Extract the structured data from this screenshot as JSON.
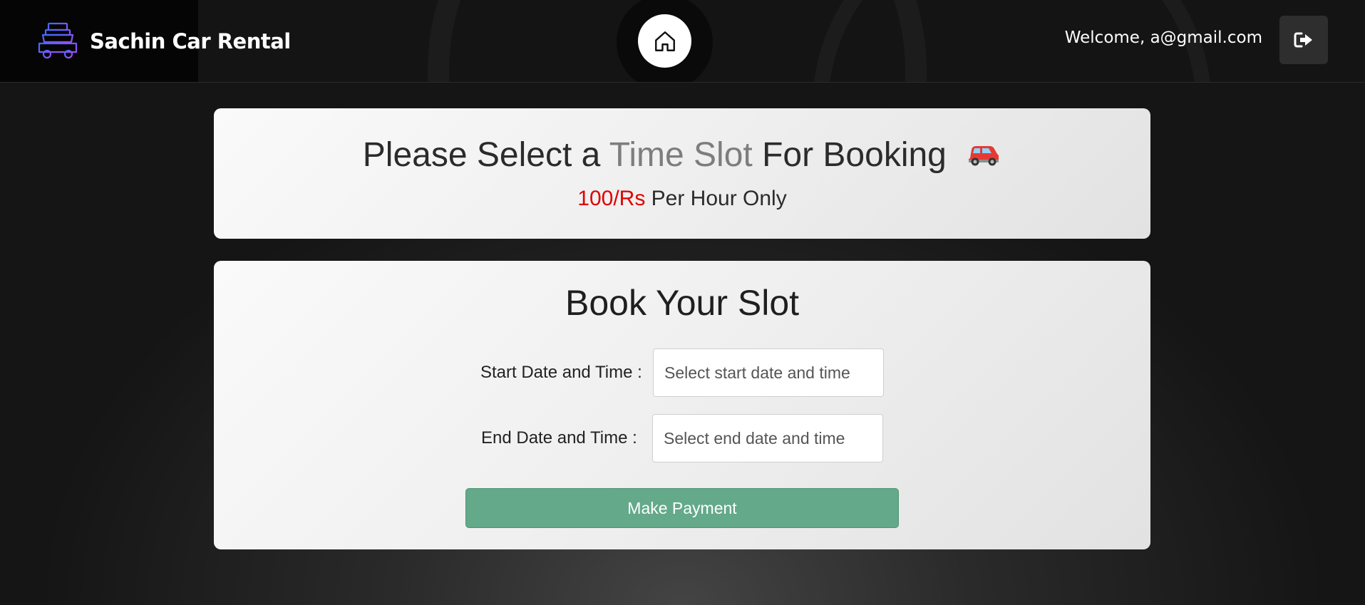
{
  "navbar": {
    "brand_name": "Sachin Car Rental",
    "brand_icon": "car-with-luggage-icon",
    "home_icon": "home-icon",
    "welcome_text": "Welcome, a@gmail.com",
    "logout_icon": "sign-out-icon"
  },
  "header_card": {
    "headline_prefix": "Please Select a ",
    "headline_accent": "Time Slot",
    "headline_suffix": " For Booking",
    "headline_emoji": "🚗",
    "price": "100/Rs",
    "price_suffix": " Per Hour Only"
  },
  "booking": {
    "title": "Book Your Slot",
    "start_label": "Start Date and Time :",
    "start_placeholder": "Select start date and time",
    "start_value": "",
    "end_label": "End Date and Time :",
    "end_placeholder": "Select end date and time",
    "end_value": "",
    "submit_label": "Make Payment"
  },
  "colors": {
    "accent_gray": "#7d7d7d",
    "price_red": "#e00000",
    "button_green": "#63a98a",
    "logo_purple": "#6a5cff"
  }
}
